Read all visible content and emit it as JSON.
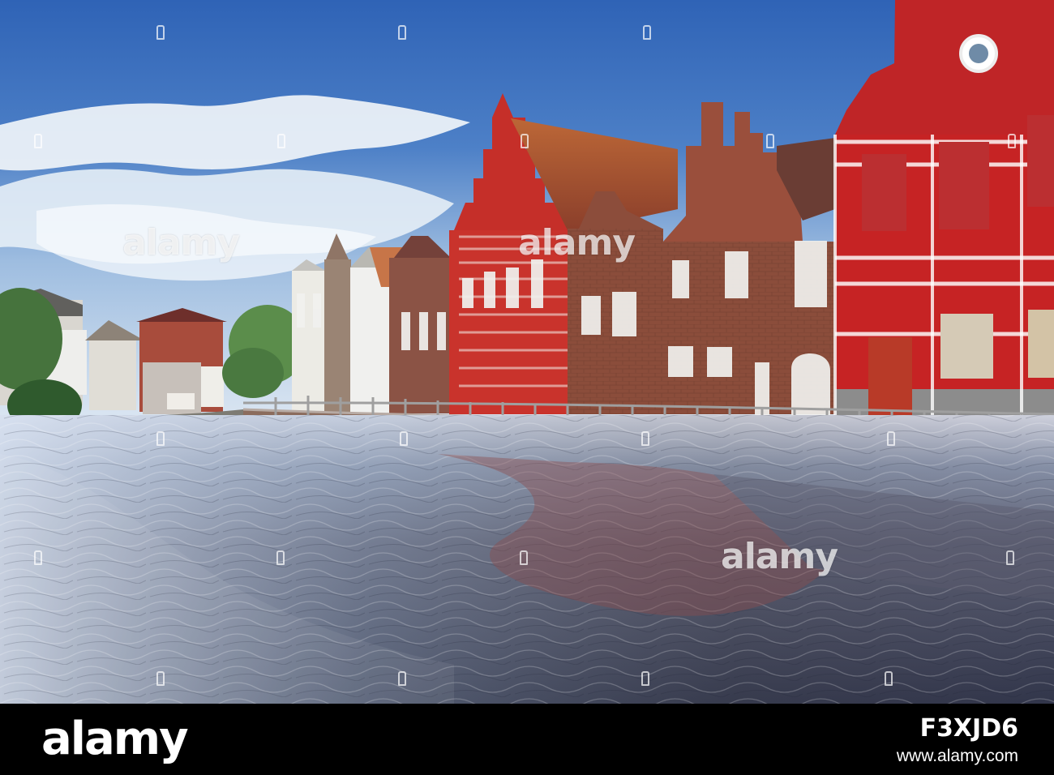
{
  "scene": {
    "subject": "canal-side historic buildings",
    "sky_color": "#3f73be",
    "cloud_color": "#eef4fb",
    "water_color": "#4e5364",
    "accent_red": "#c8262a",
    "brick_color": "#8e4f3b"
  },
  "watermarks": {
    "mark_1": "alamy",
    "mark_2": "alamy",
    "mark_3": "alamy"
  },
  "footer": {
    "brand": "alamy",
    "image_id": "F3XJD6",
    "site": "www.alamy.com"
  }
}
